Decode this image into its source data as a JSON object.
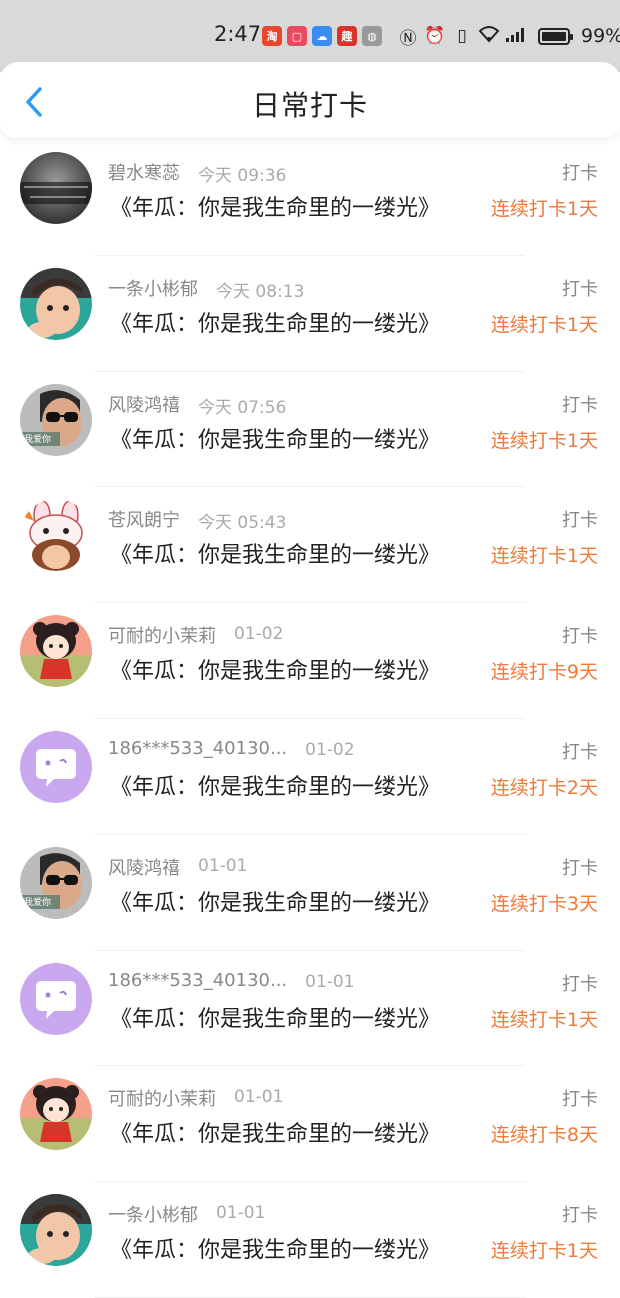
{
  "status_bar": {
    "time": "2:47",
    "battery": "99%",
    "app_icons": [
      {
        "name": "taobao-icon",
        "glyph": "淘",
        "color": "#e8462f"
      },
      {
        "name": "app-red-icon",
        "glyph": "▢",
        "color": "#e84a5f"
      },
      {
        "name": "cloud-icon",
        "glyph": "☁",
        "color": "#3c8cf0"
      },
      {
        "name": "app-news-icon",
        "glyph": "趣",
        "color": "#d8342a"
      },
      {
        "name": "wechat-icon",
        "glyph": "◍",
        "color": "#666666"
      }
    ],
    "sys_icons": [
      {
        "name": "nfc-icon",
        "glyph": "Ⓝ"
      },
      {
        "name": "alarm-icon",
        "glyph": "⏰"
      },
      {
        "name": "vibrate-icon",
        "glyph": "▯"
      },
      {
        "name": "wifi-icon",
        "glyph": "◠"
      },
      {
        "name": "signal-icon",
        "glyph": "▂▄▆"
      }
    ]
  },
  "header": {
    "title": "日常打卡",
    "back_icon": "chevron-left-icon",
    "accent_color": "#2f9bf5"
  },
  "entries": [
    {
      "user": "碧水寒蕊",
      "time": "今天 09:36",
      "label": "打卡",
      "book": "《年瓜：你是我生命里的一缕光》",
      "streak": "连续打卡1天",
      "avatar": "dark-photo"
    },
    {
      "user": "一条小彬郁",
      "time": "今天 08:13",
      "label": "打卡",
      "book": "《年瓜：你是我生命里的一缕光》",
      "streak": "连续打卡1天",
      "avatar": "boy-green"
    },
    {
      "user": "风陵鸿禧",
      "time": "今天 07:56",
      "label": "打卡",
      "book": "《年瓜：你是我生命里的一缕光》",
      "streak": "连续打卡1天",
      "avatar": "sunglasses"
    },
    {
      "user": "苍风朗宁",
      "time": "今天 05:43",
      "label": "打卡",
      "book": "《年瓜：你是我生命里的一缕光》",
      "streak": "连续打卡1天",
      "avatar": "bunny-cartoon"
    },
    {
      "user": "可耐的小茉莉",
      "time": "01-02",
      "label": "打卡",
      "book": "《年瓜：你是我生命里的一缕光》",
      "streak": "连续打卡9天",
      "avatar": "girl-cartoon"
    },
    {
      "user": "186***533_40130...",
      "time": "01-02",
      "label": "打卡",
      "book": "《年瓜：你是我生命里的一缕光》",
      "streak": "连续打卡2天",
      "avatar": "chat-bubble"
    },
    {
      "user": "风陵鸿禧",
      "time": "01-01",
      "label": "打卡",
      "book": "《年瓜：你是我生命里的一缕光》",
      "streak": "连续打卡3天",
      "avatar": "sunglasses"
    },
    {
      "user": "186***533_40130...",
      "time": "01-01",
      "label": "打卡",
      "book": "《年瓜：你是我生命里的一缕光》",
      "streak": "连续打卡1天",
      "avatar": "chat-bubble"
    },
    {
      "user": "可耐的小茉莉",
      "time": "01-01",
      "label": "打卡",
      "book": "《年瓜：你是我生命里的一缕光》",
      "streak": "连续打卡8天",
      "avatar": "girl-cartoon"
    },
    {
      "user": "一条小彬郁",
      "time": "01-01",
      "label": "打卡",
      "book": "《年瓜：你是我生命里的一缕光》",
      "streak": "连续打卡1天",
      "avatar": "boy-green"
    }
  ],
  "colors": {
    "streak": "#f07a3a",
    "muted": "#888888",
    "title": "#222222"
  }
}
